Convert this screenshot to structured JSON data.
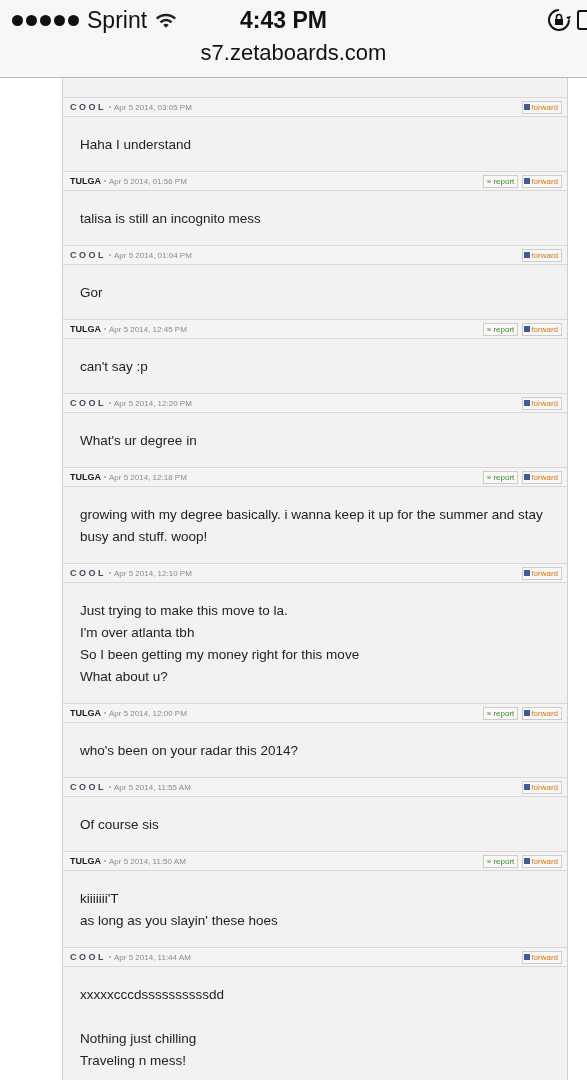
{
  "status_bar": {
    "carrier": "Sprint",
    "time": "4:43 PM"
  },
  "address_bar": {
    "url": "s7.zetaboards.com"
  },
  "posts": [
    {
      "author": "COOL",
      "kind": "spaced",
      "date": "Apr 5 2014, 03:05 PM",
      "buttons": [
        "forward"
      ],
      "body": [
        [
          "Haha I understand"
        ]
      ]
    },
    {
      "author": "TULGA",
      "kind": "bold",
      "date": "Apr 5 2014, 01:56 PM",
      "buttons": [
        "» report",
        "forward"
      ],
      "body": [
        [
          "talisa is still an incognito mess"
        ]
      ]
    },
    {
      "author": "COOL",
      "kind": "spaced",
      "date": "Apr 5 2014, 01:04 PM",
      "buttons": [
        "forward"
      ],
      "body": [
        [
          "Gor"
        ]
      ]
    },
    {
      "author": "TULGA",
      "kind": "bold",
      "date": "Apr 5 2014, 12:45 PM",
      "buttons": [
        "» report",
        "forward"
      ],
      "body": [
        [
          "can't say :p"
        ]
      ]
    },
    {
      "author": "COOL",
      "kind": "spaced",
      "date": "Apr 5 2014, 12:20 PM",
      "buttons": [
        "forward"
      ],
      "body": [
        [
          "What's ur degree in"
        ]
      ]
    },
    {
      "author": "TULGA",
      "kind": "bold",
      "date": "Apr 5 2014, 12:18 PM",
      "buttons": [
        "» report",
        "forward"
      ],
      "body": [
        [
          "growing with my degree basically. i wanna keep it up for the summer and stay busy and stuff. woop!"
        ]
      ]
    },
    {
      "author": "COOL",
      "kind": "spaced",
      "date": "Apr 5 2014, 12:10 PM",
      "buttons": [
        "forward"
      ],
      "body": [
        [
          "Just trying to make this move to la.",
          "I'm over atlanta tbh",
          "So I been getting my money right for this move",
          "What about u?"
        ]
      ]
    },
    {
      "author": "TULGA",
      "kind": "bold",
      "date": "Apr 5 2014, 12:00 PM",
      "buttons": [
        "» report",
        "forward"
      ],
      "body": [
        [
          "who's been on your radar this 2014?"
        ]
      ]
    },
    {
      "author": "COOL",
      "kind": "spaced",
      "date": "Apr 5 2014, 11:55 AM",
      "buttons": [
        "forward"
      ],
      "body": [
        [
          "Of course sis"
        ]
      ]
    },
    {
      "author": "TULGA",
      "kind": "bold",
      "date": "Apr 5 2014, 11:50 AM",
      "buttons": [
        "» report",
        "forward"
      ],
      "body": [
        [
          "kiiiiiii'T",
          "as long as you slayin' these hoes"
        ]
      ]
    },
    {
      "author": "COOL",
      "kind": "spaced",
      "date": "Apr 5 2014, 11:44 AM",
      "buttons": [
        "forward"
      ],
      "body": [
        [
          "xxxxxcccdssssssssssdd"
        ],
        [
          "Nothing just chilling",
          "Traveling n mess!"
        ]
      ]
    }
  ]
}
